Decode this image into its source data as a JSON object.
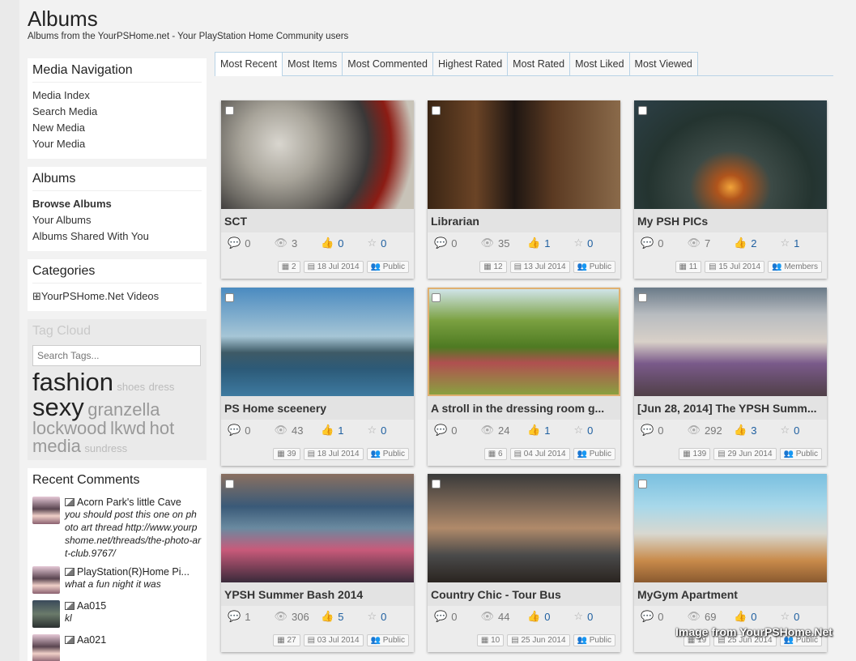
{
  "header": {
    "title": "Albums",
    "subtitle": "Albums from the YourPSHome.net - Your PlayStation Home Community users"
  },
  "sidebar": {
    "media_nav": {
      "title": "Media Navigation",
      "items": [
        "Media Index",
        "Search Media",
        "New Media",
        "Your Media"
      ]
    },
    "albums": {
      "title": "Albums",
      "items": [
        "Browse Albums",
        "Your Albums",
        "Albums Shared With You"
      ]
    },
    "categories": {
      "title": "Categories",
      "items": [
        "YourPSHome.Net Videos"
      ]
    },
    "tag_cloud": {
      "title": "Tag Cloud",
      "search_placeholder": "Search Tags...",
      "tags": [
        "fashion",
        "shoes",
        "dress",
        "sexy",
        "granzella",
        "lockwood",
        "lkwd",
        "hot",
        "media",
        "sundress"
      ]
    },
    "recent_comments": {
      "title": "Recent Comments",
      "items": [
        {
          "title": "Acorn Park's little Cave",
          "text": "you should post this one on photo art thread http://www.yourpshome.net/threads/the-photo-art-club.9767/"
        },
        {
          "title": "PlayStation(R)Home Pi...",
          "text": "what a fun night it was"
        },
        {
          "title": "Aa015",
          "text": "kl"
        },
        {
          "title": "Aa021",
          "text": ""
        }
      ]
    }
  },
  "tabs": [
    "Most Recent",
    "Most Items",
    "Most Commented",
    "Highest Rated",
    "Most Rated",
    "Most Liked",
    "Most Viewed"
  ],
  "albums": [
    {
      "title": "SCT",
      "comments": "0",
      "views": "3",
      "likes": "0",
      "rating": "0",
      "items": "2",
      "date": "18 Jul 2014",
      "privacy": "Public"
    },
    {
      "title": "Librarian",
      "comments": "0",
      "views": "35",
      "likes": "1",
      "rating": "0",
      "items": "12",
      "date": "13 Jul 2014",
      "privacy": "Public"
    },
    {
      "title": "My PSH PICs",
      "comments": "0",
      "views": "7",
      "likes": "2",
      "rating": "1",
      "items": "11",
      "date": "15 Jul 2014",
      "privacy": "Members"
    },
    {
      "title": "PS Home sceenery",
      "comments": "0",
      "views": "43",
      "likes": "1",
      "rating": "0",
      "items": "39",
      "date": "18 Jul 2014",
      "privacy": "Public"
    },
    {
      "title": "A stroll in the dressing room g...",
      "comments": "0",
      "views": "24",
      "likes": "1",
      "rating": "0",
      "items": "6",
      "date": "04 Jul 2014",
      "privacy": "Public"
    },
    {
      "title": "[Jun 28, 2014] The YPSH Summ...",
      "comments": "0",
      "views": "292",
      "likes": "3",
      "rating": "0",
      "items": "139",
      "date": "29 Jun 2014",
      "privacy": "Public"
    },
    {
      "title": "YPSH Summer Bash 2014",
      "comments": "1",
      "views": "306",
      "likes": "5",
      "rating": "0",
      "items": "27",
      "date": "03 Jul 2014",
      "privacy": "Public"
    },
    {
      "title": "Country Chic - Tour Bus",
      "comments": "0",
      "views": "44",
      "likes": "0",
      "rating": "0",
      "items": "10",
      "date": "25 Jun 2014",
      "privacy": "Public"
    },
    {
      "title": "MyGym Apartment",
      "comments": "0",
      "views": "69",
      "likes": "0",
      "rating": "0",
      "items": "19",
      "date": "25 Jun 2014",
      "privacy": "Public"
    }
  ],
  "watermark": "Image from YourPSHome.Net",
  "colors": {
    "link_blue": "#1e5fa0",
    "tab_border": "#b9d3e6"
  }
}
